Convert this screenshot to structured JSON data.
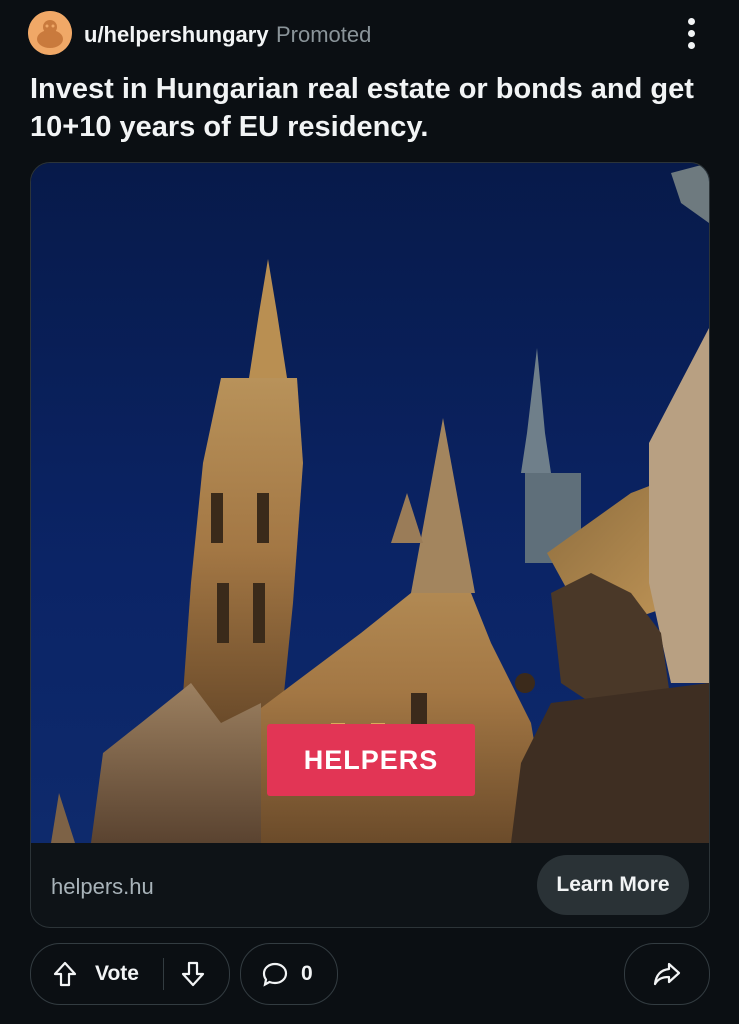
{
  "post": {
    "username": "u/helpershungary",
    "promoted_label": "Promoted",
    "title": "Invest in Hungarian real estate or bonds and get 10+10 years of EU residency."
  },
  "ad": {
    "brand_text": "HELPERS",
    "domain": "helpers.hu",
    "cta_label": "Learn More"
  },
  "actions": {
    "vote_label": "Vote",
    "comment_count": "0"
  },
  "icons": {
    "more": "more-vertical-icon",
    "upvote": "arrow-up-icon",
    "downvote": "arrow-down-icon",
    "comment": "comment-bubble-icon",
    "share": "share-arrow-icon"
  },
  "colors": {
    "background": "#0b0f13",
    "badge": "#e23555",
    "avatar": "#f0a867",
    "muted_text": "#8a9499"
  }
}
